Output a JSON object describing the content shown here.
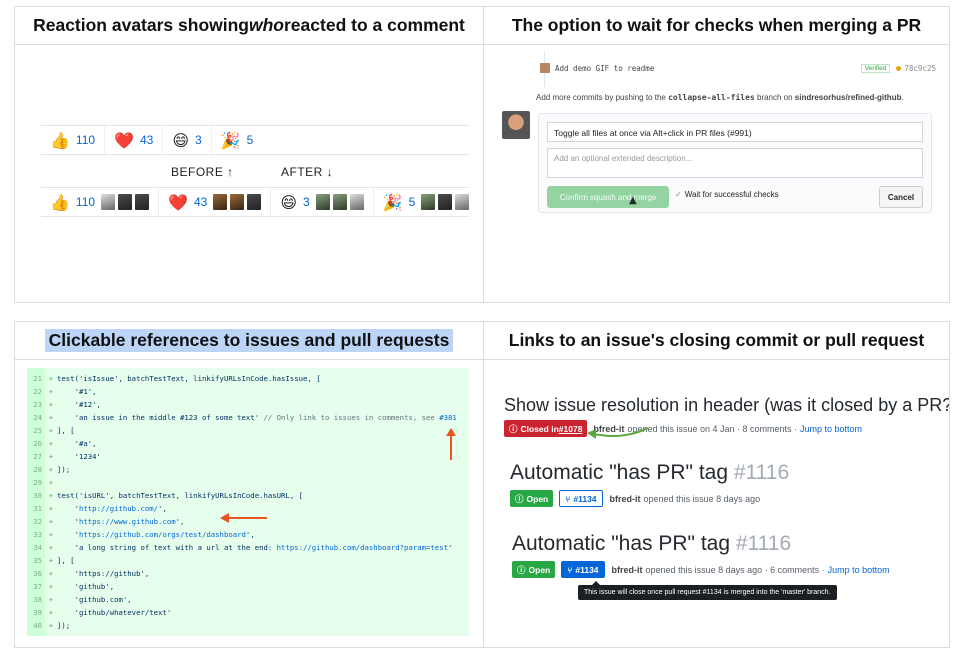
{
  "panel1": {
    "title_before": "Reaction avatars showing ",
    "title_em": "who",
    "title_after": " reacted to a comment",
    "reactions": [
      {
        "emoji": "👍",
        "count": "110"
      },
      {
        "emoji": "❤️",
        "count": "43"
      },
      {
        "emoji": "😄",
        "count": "3"
      },
      {
        "emoji": "🎉",
        "count": "5"
      }
    ],
    "before_label": "BEFORE ↑",
    "after_label": "AFTER ↓"
  },
  "panel2": {
    "title": "The option to wait for checks when merging a PR",
    "commit_message": "Add demo GIF to readme",
    "verified": "Verified",
    "sha": "78c9c25",
    "hint_prefix": "Add more commits by pushing to the ",
    "hint_branch": "collapse-all-files",
    "hint_mid": " branch on ",
    "hint_repo": "sindresorhus/refined-github",
    "hint_end": ".",
    "commit_title_value": "Toggle all files at once via Alt+click in PR files (#991)",
    "description_placeholder": "Add an optional extended description...",
    "confirm_button": "Confirm squash and merge",
    "wait_checkbox_label": "Wait for successful checks",
    "cancel_button": "Cancel"
  },
  "panel3": {
    "title": "Clickable references to issues and pull requests",
    "lines": [
      {
        "n": "21",
        "code": "test('isIssue', batchTestText, linkifyURLsInCode.hasIssue, ["
      },
      {
        "n": "22",
        "code": "    '#1',"
      },
      {
        "n": "23",
        "code": "    '#12',"
      },
      {
        "n": "24",
        "code": "    'an issue in the middle #123 of some text' ",
        "comment": "// Only link to issues in comments, see ",
        "link": "#381"
      },
      {
        "n": "25",
        "code": "], ["
      },
      {
        "n": "26",
        "code": "    '#a',"
      },
      {
        "n": "27",
        "code": "    '1234'"
      },
      {
        "n": "28",
        "code": "]);"
      },
      {
        "n": "29",
        "code": ""
      },
      {
        "n": "30",
        "code": "test('isURL', batchTestText, linkifyURLsInCode.hasURL, ["
      },
      {
        "n": "31",
        "code": "    '",
        "link": "http://github.com/",
        "end": "',"
      },
      {
        "n": "32",
        "code": "    '",
        "link": "https://www.github.com",
        "end": "',"
      },
      {
        "n": "33",
        "code": "    '",
        "link": "https://github.com/orgs/test/dashboard",
        "end": "',"
      },
      {
        "n": "34",
        "code": "    'a long string of text with a url at the end: ",
        "link": "https://github.com/dashboard?param=test",
        "end": "'"
      },
      {
        "n": "35",
        "code": "], ["
      },
      {
        "n": "36",
        "code": "    'https://github',"
      },
      {
        "n": "37",
        "code": "    'github',"
      },
      {
        "n": "38",
        "code": "    'github.com',"
      },
      {
        "n": "39",
        "code": "    'github/whatever/text'"
      },
      {
        "n": "40",
        "code": "]);"
      }
    ]
  },
  "panel4": {
    "title": "Links to an issue's closing commit or pull request",
    "issue1": {
      "title": "Show issue resolution in header (was it closed by a PR?)",
      "state_prefix": "Closed in ",
      "state_ref": "#1078",
      "author": "bfred-it",
      "meta": "opened this issue on 4 Jan · 8 comments ·",
      "jump": "Jump to bottom"
    },
    "issue2": {
      "title": "Automatic \"has PR\" tag",
      "number": "#1116",
      "state": "Open",
      "pr": "#1134",
      "author": "bfred-it",
      "meta": "opened this issue 8 days ago"
    },
    "issue3": {
      "title": "Automatic \"has PR\" tag",
      "number": "#1116",
      "state": "Open",
      "pr": "#1134",
      "author": "bfred-it",
      "meta": "opened this issue 8 days ago · 6 comments ·",
      "jump": "Jump to bottom",
      "tooltip": "This issue will close once pull request #1134 is merged into the 'master' branch."
    }
  },
  "colors": {
    "link": "#0366d6",
    "green": "#28a745",
    "red": "#cb2431",
    "arrow": "#e8541f",
    "highlight": "#bcd4f6",
    "code_bg": "#e6ffed"
  }
}
